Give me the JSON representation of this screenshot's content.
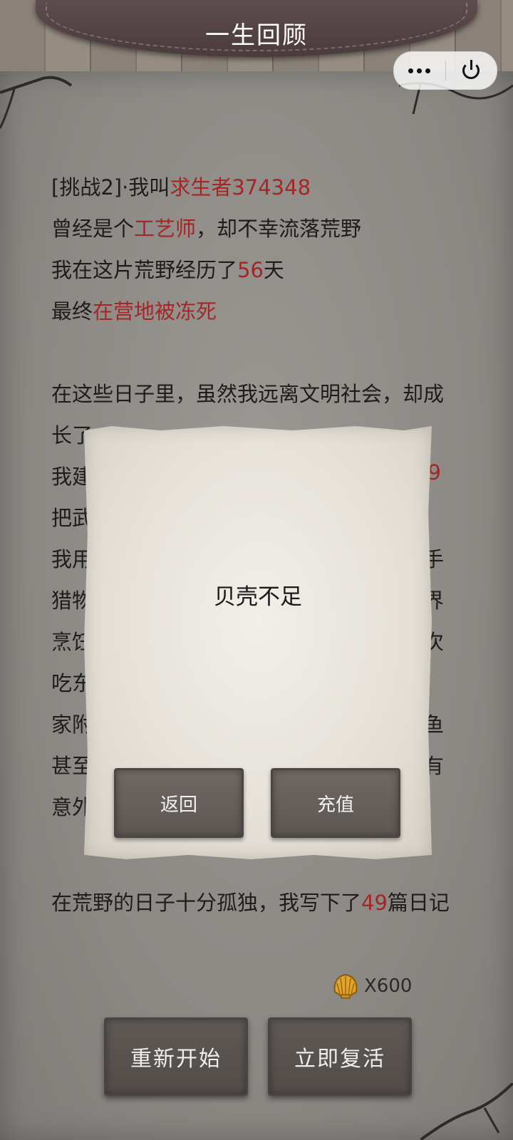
{
  "header": {
    "title": "一生回顾"
  },
  "capsule": {
    "more_icon": "more-dots-icon",
    "close_icon": "power-icon"
  },
  "story": {
    "line1": {
      "prefix": "[挑战2]·我叫",
      "name": "求生者374348"
    },
    "line2": {
      "prefix": "曾经是个",
      "job": "工艺师",
      "suffix": "，却不幸流落荒野"
    },
    "line3": {
      "prefix": "我在这片荒野经历了",
      "days": "56",
      "suffix": "天"
    },
    "line4": {
      "prefix": "最终",
      "death": "在营地被冻死"
    },
    "para2_line1": "在这些日子里，虽然我远离文明社会，却成",
    "para2_line2": "长了",
    "para2_line3_prefix": "我建",
    "para2_line3_num": "29",
    "para2_line4": "把武",
    "para2_line5_left": "我用",
    "para2_line5_right": "手",
    "para2_line6_left": "猎物",
    "para2_line6_right": "界",
    "para2_line7_left": "烹饪",
    "para2_line7_right": "次",
    "para2_line8_left": "吃东",
    "para2_line9_left": "家附",
    "para2_line9_right": "鱼",
    "para2_line10_left": "甚至",
    "para2_line10_right": "有",
    "para2_line11_left": "意外",
    "diary": {
      "prefix": "在荒野的日子十分孤独，我写下了",
      "count": "49",
      "suffix": "篇日记"
    }
  },
  "cost": {
    "icon": "shell-icon",
    "text": "X600"
  },
  "buttons": {
    "restart": "重新开始",
    "revive": "立即复活"
  },
  "modal": {
    "message": "贝壳不足",
    "back": "返回",
    "recharge": "充值"
  },
  "colors": {
    "highlight": "#a42626",
    "paper": "#8c8985",
    "header": "#4a3b3d"
  }
}
